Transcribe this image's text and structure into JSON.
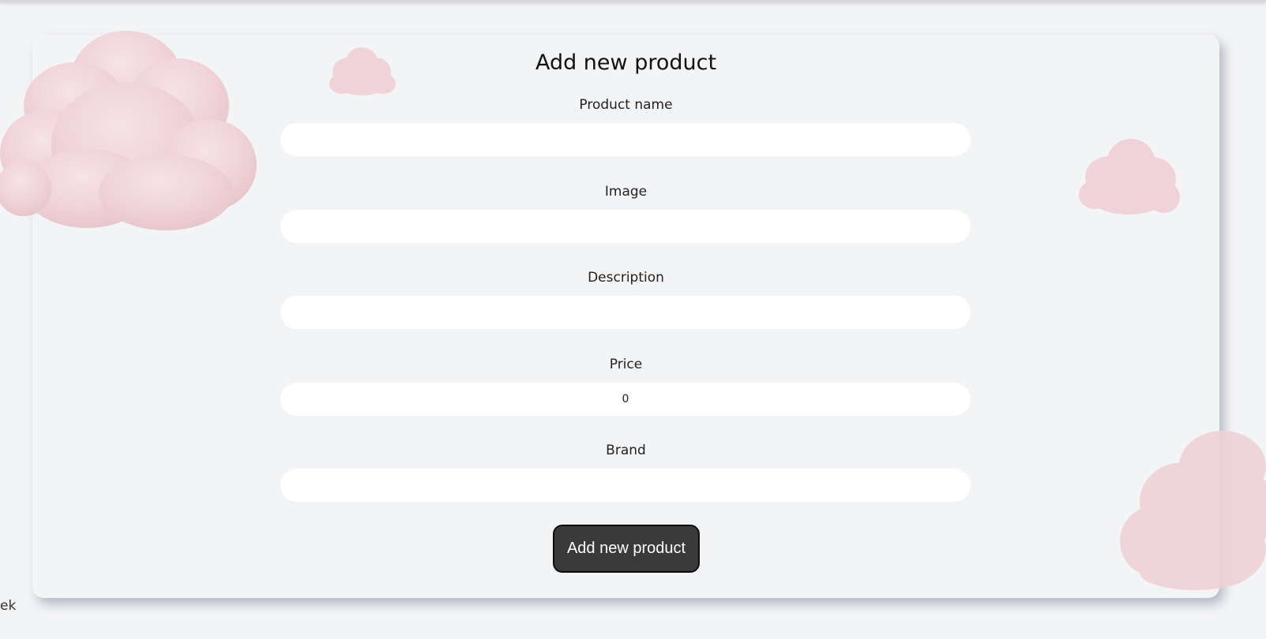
{
  "form": {
    "title": "Add new product",
    "fields": [
      {
        "label": "Product name",
        "value": ""
      },
      {
        "label": "Image",
        "value": ""
      },
      {
        "label": "Description",
        "value": ""
      },
      {
        "label": "Price",
        "value": "0"
      },
      {
        "label": "Brand",
        "value": ""
      }
    ],
    "submit_label": "Add new product"
  },
  "footer": {
    "text": "ek"
  },
  "colors": {
    "background": "#f3f4f6",
    "card": "#f3f4f6",
    "input_bg": "#ffffff",
    "button_bg": "#3a3a3a",
    "button_text": "#ffffff",
    "cloud": "#f0d2d6"
  }
}
